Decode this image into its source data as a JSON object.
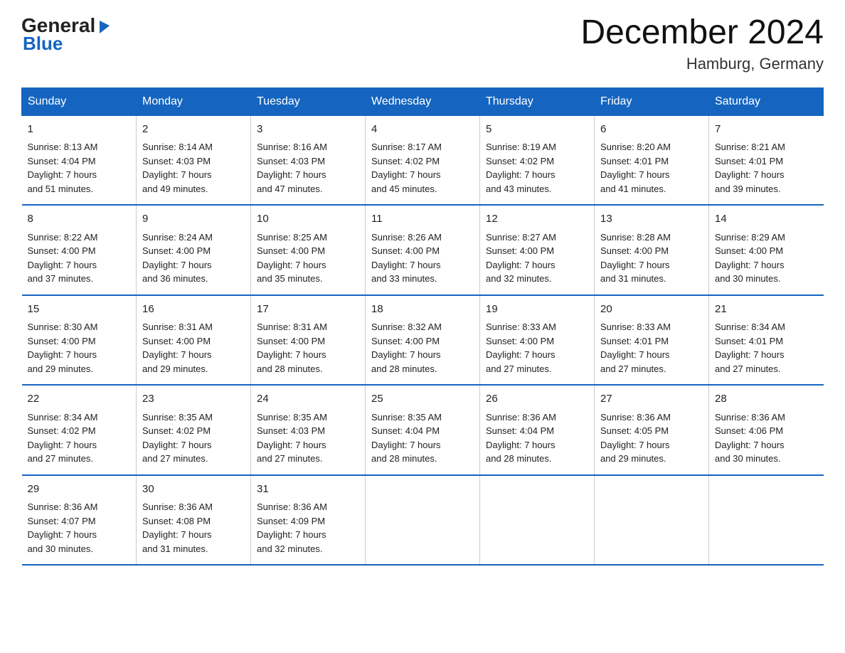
{
  "logo": {
    "general": "General",
    "triangle": "▶",
    "blue": "Blue"
  },
  "title": "December 2024",
  "subtitle": "Hamburg, Germany",
  "days_header": [
    "Sunday",
    "Monday",
    "Tuesday",
    "Wednesday",
    "Thursday",
    "Friday",
    "Saturday"
  ],
  "weeks": [
    [
      {
        "day": "1",
        "info": "Sunrise: 8:13 AM\nSunset: 4:04 PM\nDaylight: 7 hours\nand 51 minutes."
      },
      {
        "day": "2",
        "info": "Sunrise: 8:14 AM\nSunset: 4:03 PM\nDaylight: 7 hours\nand 49 minutes."
      },
      {
        "day": "3",
        "info": "Sunrise: 8:16 AM\nSunset: 4:03 PM\nDaylight: 7 hours\nand 47 minutes."
      },
      {
        "day": "4",
        "info": "Sunrise: 8:17 AM\nSunset: 4:02 PM\nDaylight: 7 hours\nand 45 minutes."
      },
      {
        "day": "5",
        "info": "Sunrise: 8:19 AM\nSunset: 4:02 PM\nDaylight: 7 hours\nand 43 minutes."
      },
      {
        "day": "6",
        "info": "Sunrise: 8:20 AM\nSunset: 4:01 PM\nDaylight: 7 hours\nand 41 minutes."
      },
      {
        "day": "7",
        "info": "Sunrise: 8:21 AM\nSunset: 4:01 PM\nDaylight: 7 hours\nand 39 minutes."
      }
    ],
    [
      {
        "day": "8",
        "info": "Sunrise: 8:22 AM\nSunset: 4:00 PM\nDaylight: 7 hours\nand 37 minutes."
      },
      {
        "day": "9",
        "info": "Sunrise: 8:24 AM\nSunset: 4:00 PM\nDaylight: 7 hours\nand 36 minutes."
      },
      {
        "day": "10",
        "info": "Sunrise: 8:25 AM\nSunset: 4:00 PM\nDaylight: 7 hours\nand 35 minutes."
      },
      {
        "day": "11",
        "info": "Sunrise: 8:26 AM\nSunset: 4:00 PM\nDaylight: 7 hours\nand 33 minutes."
      },
      {
        "day": "12",
        "info": "Sunrise: 8:27 AM\nSunset: 4:00 PM\nDaylight: 7 hours\nand 32 minutes."
      },
      {
        "day": "13",
        "info": "Sunrise: 8:28 AM\nSunset: 4:00 PM\nDaylight: 7 hours\nand 31 minutes."
      },
      {
        "day": "14",
        "info": "Sunrise: 8:29 AM\nSunset: 4:00 PM\nDaylight: 7 hours\nand 30 minutes."
      }
    ],
    [
      {
        "day": "15",
        "info": "Sunrise: 8:30 AM\nSunset: 4:00 PM\nDaylight: 7 hours\nand 29 minutes."
      },
      {
        "day": "16",
        "info": "Sunrise: 8:31 AM\nSunset: 4:00 PM\nDaylight: 7 hours\nand 29 minutes."
      },
      {
        "day": "17",
        "info": "Sunrise: 8:31 AM\nSunset: 4:00 PM\nDaylight: 7 hours\nand 28 minutes."
      },
      {
        "day": "18",
        "info": "Sunrise: 8:32 AM\nSunset: 4:00 PM\nDaylight: 7 hours\nand 28 minutes."
      },
      {
        "day": "19",
        "info": "Sunrise: 8:33 AM\nSunset: 4:00 PM\nDaylight: 7 hours\nand 27 minutes."
      },
      {
        "day": "20",
        "info": "Sunrise: 8:33 AM\nSunset: 4:01 PM\nDaylight: 7 hours\nand 27 minutes."
      },
      {
        "day": "21",
        "info": "Sunrise: 8:34 AM\nSunset: 4:01 PM\nDaylight: 7 hours\nand 27 minutes."
      }
    ],
    [
      {
        "day": "22",
        "info": "Sunrise: 8:34 AM\nSunset: 4:02 PM\nDaylight: 7 hours\nand 27 minutes."
      },
      {
        "day": "23",
        "info": "Sunrise: 8:35 AM\nSunset: 4:02 PM\nDaylight: 7 hours\nand 27 minutes."
      },
      {
        "day": "24",
        "info": "Sunrise: 8:35 AM\nSunset: 4:03 PM\nDaylight: 7 hours\nand 27 minutes."
      },
      {
        "day": "25",
        "info": "Sunrise: 8:35 AM\nSunset: 4:04 PM\nDaylight: 7 hours\nand 28 minutes."
      },
      {
        "day": "26",
        "info": "Sunrise: 8:36 AM\nSunset: 4:04 PM\nDaylight: 7 hours\nand 28 minutes."
      },
      {
        "day": "27",
        "info": "Sunrise: 8:36 AM\nSunset: 4:05 PM\nDaylight: 7 hours\nand 29 minutes."
      },
      {
        "day": "28",
        "info": "Sunrise: 8:36 AM\nSunset: 4:06 PM\nDaylight: 7 hours\nand 30 minutes."
      }
    ],
    [
      {
        "day": "29",
        "info": "Sunrise: 8:36 AM\nSunset: 4:07 PM\nDaylight: 7 hours\nand 30 minutes."
      },
      {
        "day": "30",
        "info": "Sunrise: 8:36 AM\nSunset: 4:08 PM\nDaylight: 7 hours\nand 31 minutes."
      },
      {
        "day": "31",
        "info": "Sunrise: 8:36 AM\nSunset: 4:09 PM\nDaylight: 7 hours\nand 32 minutes."
      },
      {
        "day": "",
        "info": ""
      },
      {
        "day": "",
        "info": ""
      },
      {
        "day": "",
        "info": ""
      },
      {
        "day": "",
        "info": ""
      }
    ]
  ]
}
